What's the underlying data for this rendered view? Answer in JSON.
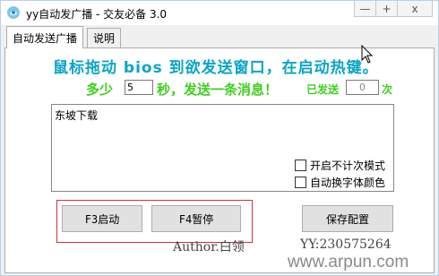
{
  "window": {
    "title": "yy自动发广播 - 交友必备  3.0",
    "controls": {
      "minimize": "—",
      "restore": "+",
      "close": "x"
    }
  },
  "tabs": [
    {
      "label": "自动发送广播",
      "active": true
    },
    {
      "label": "说明",
      "active": false
    }
  ],
  "main": {
    "headline": "鼠标拖动 bios 到欲发送窗口，在启动热键。",
    "interval_prefix": "多少",
    "interval_value": "5",
    "interval_suffix": "秒，发送一条消息！",
    "sent_label": "已发送",
    "sent_count": "0",
    "sent_unit": "次",
    "message_text": "东坡下载",
    "options": [
      {
        "label": "开启不计次模式",
        "checked": false
      },
      {
        "label": "自动换字体颜色",
        "checked": false
      }
    ],
    "buttons": {
      "start": "F3启动",
      "pause": "F4暂停",
      "save": "保存配置"
    },
    "author": "Author.白领",
    "qq": "YY:230575264"
  },
  "watermark": "www.arpun.com",
  "colors": {
    "headline": "#0aa4c8",
    "green": "#3ecf1e",
    "highlight_frame": "#d62d3a"
  }
}
